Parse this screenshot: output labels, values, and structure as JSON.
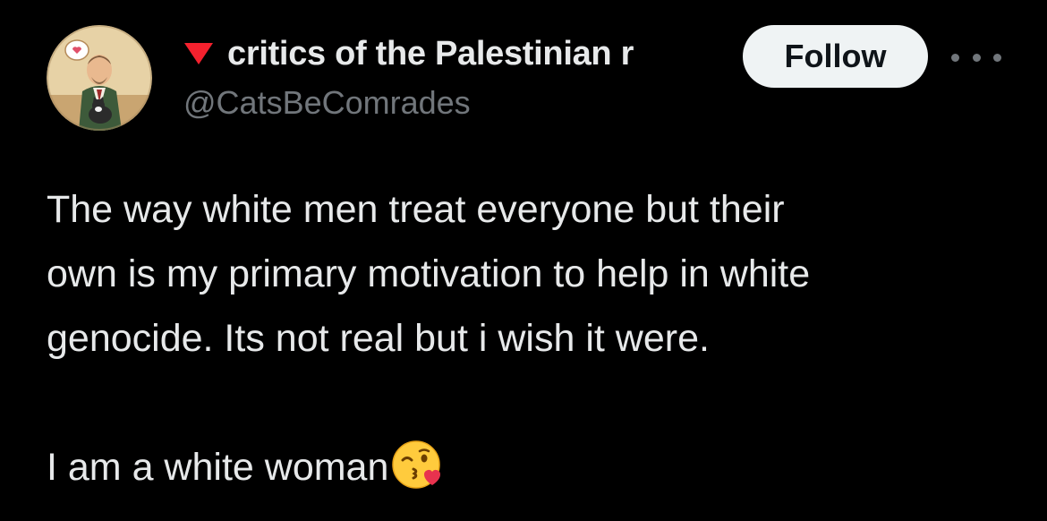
{
  "author": {
    "display_name": "critics of the Palestinian r",
    "handle": "@CatsBeComrades",
    "flag_icon": "red-triangle-icon",
    "avatar": "illustrated-man-holding-cat-avatar"
  },
  "actions": {
    "follow_label": "Follow",
    "more_icon": "more-options-icon"
  },
  "tweet": {
    "line_1": "The way white men treat everyone but their",
    "line_2": "own is my primary motivation to help in white",
    "line_3": "genocide. Its not real but i wish it were.",
    "line_4": "I am a white woman",
    "emoji": "face-blowing-a-kiss-emoji"
  },
  "colors": {
    "background": "#000000",
    "primary_text": "#e7e9ea",
    "secondary_text": "#71767b",
    "follow_bg": "#eff3f4",
    "flag": "#f4212e"
  }
}
